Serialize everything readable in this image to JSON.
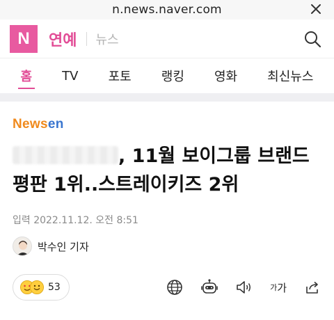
{
  "browser": {
    "url": "n.news.naver.com",
    "close_icon": "close-icon"
  },
  "header": {
    "logo_text": "N",
    "section": "연예",
    "subsection": "뉴스",
    "search_icon": "search-icon",
    "colors": {
      "accent": "#e24c96",
      "logo_bg": "#e85aa0"
    }
  },
  "tabs": [
    {
      "label": "홈",
      "active": true
    },
    {
      "label": "TV",
      "active": false
    },
    {
      "label": "포토",
      "active": false
    },
    {
      "label": "랭킹",
      "active": false
    },
    {
      "label": "영화",
      "active": false
    },
    {
      "label": "최신뉴스",
      "active": false
    }
  ],
  "article": {
    "press_logo": {
      "part1": "News",
      "part2": "en"
    },
    "headline_rest": ", 11월 보이그룹 브랜드 평판 1위..스트레이키즈 2위",
    "published": "입력 2022.11.12. 오전 8:51",
    "reporter": "박수인 기자"
  },
  "toolbar": {
    "reaction_count": "53",
    "icons": [
      "globe-icon",
      "robot-icon",
      "speaker-icon",
      "font-size-icon",
      "share-icon"
    ],
    "font_small": "가",
    "font_large": "가"
  }
}
